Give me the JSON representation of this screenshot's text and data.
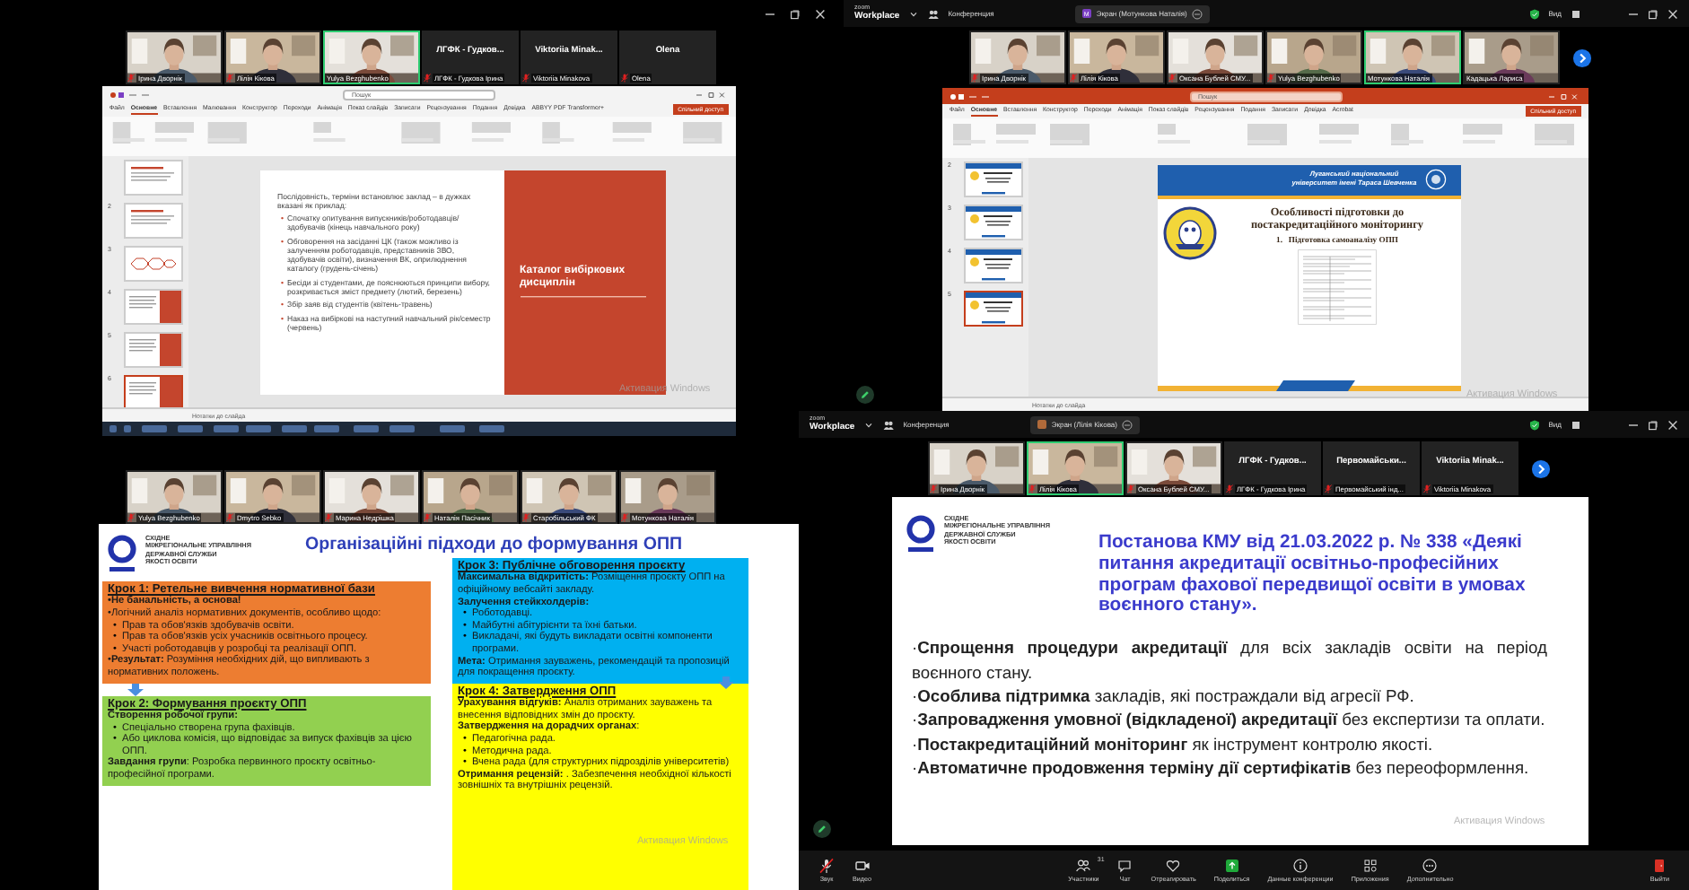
{
  "top_left": {
    "participants": [
      {
        "kind": "video",
        "label": "Ірина Дворнік",
        "muted": true,
        "active_speaker": false
      },
      {
        "kind": "video",
        "label": "Лілія Кікова",
        "muted": true,
        "active_speaker": false
      },
      {
        "kind": "video",
        "label": "Yulya Bezghubenko",
        "muted": false,
        "active_speaker": true
      },
      {
        "kind": "name",
        "name": "ЛГФК - Гудков...",
        "label": "ЛГФК - Гудкова Ірина",
        "muted": true,
        "active_speaker": false
      },
      {
        "kind": "name",
        "name": "Viktoriia Minak...",
        "label": "Viktoriia Minakova",
        "muted": true,
        "active_speaker": false
      },
      {
        "kind": "name",
        "name": "Olena",
        "label": "Olena",
        "muted": true,
        "active_speaker": false
      }
    ],
    "powerpoint": {
      "kind": "light",
      "search": "Пошук",
      "share_button": "Спільний доступ",
      "notes": "Нотатки до слайда",
      "tabs": [
        {
          "label": "Файл",
          "selected": false
        },
        {
          "label": "Основне",
          "selected": true
        },
        {
          "label": "Вставлення",
          "selected": false
        },
        {
          "label": "Малювання",
          "selected": false
        },
        {
          "label": "Конструктор",
          "selected": false
        },
        {
          "label": "Переходи",
          "selected": false
        },
        {
          "label": "Анімація",
          "selected": false
        },
        {
          "label": "Показ слайдів",
          "selected": false
        },
        {
          "label": "Записати",
          "selected": false
        },
        {
          "label": "Рецензування",
          "selected": false
        },
        {
          "label": "Подання",
          "selected": false
        },
        {
          "label": "Довідка",
          "selected": false
        },
        {
          "label": "ABBYY PDF Transformer+",
          "selected": false
        }
      ],
      "thumbnails": [
        {
          "kind": "text",
          "selected": false
        },
        {
          "number": "2",
          "kind": "text",
          "selected": false
        },
        {
          "number": "3",
          "kind": "diagram",
          "selected": false
        },
        {
          "number": "4",
          "kind": "red",
          "selected": false
        },
        {
          "number": "5",
          "kind": "red",
          "selected": false
        },
        {
          "number": "6",
          "kind": "red",
          "selected": true
        }
      ]
    },
    "slide": {
      "kind": "catalog",
      "intro": "Послідовність, терміни встановлює заклад – в дужках вказані як приклад:",
      "bullets": [
        {
          "marker": "•",
          "text": "Спочатку опитування випускників/роботодавців/здобувачів (кінець навчального року)"
        },
        {
          "marker": "•",
          "text": "Обговорення на засіданні ЦК (також можливо із залученням роботодавців, представників ЗВО, здобувачів освіти), визначення ВК, оприлюднення каталогу (грудень-січень)"
        },
        {
          "marker": "•",
          "text": "Бесіди зі студентами, де пояснюються принципи вибору, розкривається зміст предмету (лютий, березень)"
        },
        {
          "marker": "•",
          "text": "Збір заяв від студентів (квітень-травень)"
        },
        {
          "marker": "•",
          "text": "Наказ на вибіркові на наступний навчальний рік/семестр (червень)"
        }
      ],
      "panel_title": "Каталог вибіркових дисциплін"
    },
    "watermark": "Активация Windows"
  },
  "top_right": {
    "header": {
      "logo_top": "zoom",
      "logo_bottom": "Workplace",
      "meeting": "Конференция",
      "avatar": "M",
      "share_pill": "Экран (Мотункова Наталія)",
      "view": "Вид"
    },
    "participants": [
      {
        "kind": "video",
        "label": "Ірина Дворнік",
        "muted": true,
        "active_speaker": false
      },
      {
        "kind": "video",
        "label": "Лілія Кікова",
        "muted": true,
        "active_speaker": false
      },
      {
        "kind": "video",
        "label": "Оксана Бублей СМУ...",
        "muted": true,
        "active_speaker": false
      },
      {
        "kind": "video",
        "label": "Yulya Bezghubenko",
        "muted": true,
        "active_speaker": false
      },
      {
        "kind": "video",
        "label": "Мотункова Наталія",
        "muted": false,
        "active_speaker": true
      },
      {
        "kind": "video",
        "label": "Кадацька Лариса",
        "muted": false,
        "active_speaker": false
      }
    ],
    "powerpoint": {
      "kind": "accent",
      "search": "Пошук",
      "share_button": "Спільний доступ",
      "notes": "Нотатки до слайда",
      "tabs": [
        {
          "label": "Файл",
          "selected": false
        },
        {
          "label": "Основне",
          "selected": true
        },
        {
          "label": "Вставлення",
          "selected": false
        },
        {
          "label": "Конструктор",
          "selected": false
        },
        {
          "label": "Переходи",
          "selected": false
        },
        {
          "label": "Анімація",
          "selected": false
        },
        {
          "label": "Показ слайдів",
          "selected": false
        },
        {
          "label": "Рецензування",
          "selected": false
        },
        {
          "label": "Подання",
          "selected": false
        },
        {
          "label": "Записати",
          "selected": false
        },
        {
          "label": "Довідка",
          "selected": false
        },
        {
          "label": "Acrobat",
          "selected": false
        }
      ],
      "thumbnails": [
        {
          "number": "2",
          "kind": "blue",
          "selected": false
        },
        {
          "number": "3",
          "kind": "blue",
          "selected": false
        },
        {
          "number": "4",
          "kind": "blue",
          "selected": false
        },
        {
          "number": "5",
          "kind": "blue",
          "selected": true
        }
      ]
    },
    "slide": {
      "kind": "university",
      "university": "Луганський національний університет імені Тараса Шевченка",
      "title": "Особливості підготовки до постакредитаційного моніторингу",
      "item": "1.   Підготовка самоаналізу ОПП"
    },
    "watermark": "Активация Windows"
  },
  "bottom_left": {
    "participants": [
      {
        "kind": "video",
        "label": "Yulya Bezghubenko",
        "muted": true,
        "active_speaker": false
      },
      {
        "kind": "video",
        "label": "Dmytro Sebko",
        "muted": true,
        "active_speaker": false
      },
      {
        "kind": "video",
        "label": "Марина Недрішка",
        "muted": true,
        "active_speaker": false
      },
      {
        "kind": "video",
        "label": "Наталія Пасічник",
        "muted": true,
        "active_speaker": false
      },
      {
        "kind": "video",
        "label": "Старобільський ФК",
        "muted": true,
        "active_speaker": false
      },
      {
        "kind": "video",
        "label": "Мотункова Наталія",
        "muted": true,
        "active_speaker": false
      }
    ],
    "slide": {
      "org_lines": [
        "СХІДНЕ",
        "МІЖРЕГІОНАЛЬНЕ УПРАВЛІННЯ",
        "ДЕРЖАВНОЇ СЛУЖБИ",
        "ЯКОСТІ ОСВІТИ"
      ],
      "title": "Організаційні підходи до формування ОПП",
      "steps": [
        {
          "color": "#ed7d31",
          "heading": "Крок 1: Ретельне вивчення нормативної бази",
          "items": [
            {
              "kind": "text",
              "text": "**•Не банальність, а основа!**"
            },
            {
              "kind": "text",
              "text": "•Логічний аналіз нормативних документів, особливо щодо:"
            },
            {
              "kind": "bullet",
              "marker": "•",
              "text": "Прав та обов'язків здобувачів освіти."
            },
            {
              "kind": "bullet",
              "marker": "•",
              "text": "Прав та обов'язків усіх учасників освітнього процесу."
            },
            {
              "kind": "bullet",
              "marker": "•",
              "text": "Участі роботодавців у розробці та реалізації ОПП."
            },
            {
              "kind": "text",
              "text": "•**Результат:** Розуміння необхідних дій, що випливають з нормативних положень."
            }
          ]
        },
        {
          "color": "#92d050",
          "heading": "Крок 2: Формування проєкту ОПП",
          "items": [
            {
              "kind": "text",
              "text": "**Створення робочої групи:**"
            },
            {
              "kind": "bullet",
              "marker": "•",
              "text": "Спеціально створена група фахівців."
            },
            {
              "kind": "bullet",
              "marker": "•",
              "text": "Або циклова комісія, що відповідає за випуск фахівців за цією ОПП."
            },
            {
              "kind": "text",
              "text": "**Завдання групи**: Розробка первинного проєкту освітньо-професійної програми."
            }
          ]
        },
        {
          "color": "#00b0f0",
          "heading": "Крок 3: Публічне обговорення проєкту",
          "items": [
            {
              "kind": "text",
              "text": "**Максимальна відкритість:** Розміщення проєкту ОПП на офіційному вебсайті закладу."
            },
            {
              "kind": "text",
              "text": "**Залучення стейкхолдерів:**"
            },
            {
              "kind": "bullet",
              "marker": "•",
              "text": "Роботодавці."
            },
            {
              "kind": "bullet",
              "marker": "•",
              "text": "Майбутні абітурієнти та їхні батьки."
            },
            {
              "kind": "bullet",
              "marker": "•",
              "text": "Викладачі, які будуть викладати освітні компоненти програми."
            },
            {
              "kind": "text",
              "text": "**Мета:** Отримання зауважень, рекомендацій та пропозицій для покращення проєкту."
            }
          ]
        },
        {
          "color": "#ffff00",
          "heading": "Крок 4: Затвердження ОПП",
          "items": [
            {
              "kind": "text",
              "text": "**Урахування відгуків:** Аналіз отриманих зауважень та внесення відповідних змін до проєкту."
            },
            {
              "kind": "text",
              "text": "**Затвердження на дорадчих органах**:"
            },
            {
              "kind": "bullet",
              "marker": "•",
              "text": "Педагогічна рада."
            },
            {
              "kind": "bullet",
              "marker": "•",
              "text": "Методична рада."
            },
            {
              "kind": "bullet",
              "marker": "•",
              "text": "Вчена рада (для структурних підрозділів університетів)"
            },
            {
              "kind": "text",
              "text": "**Отримання рецензій:** . Забезпечення необхідної кількості зовнішніх та внутрішніх рецензій."
            }
          ]
        }
      ]
    },
    "watermark": "Активация Windows"
  },
  "bottom_right": {
    "header": {
      "logo_top": "zoom",
      "logo_bottom": "Workplace",
      "meeting": "Конференция",
      "share_pill": "Экран (Лілія Кікова)",
      "view": "Вид"
    },
    "participants": [
      {
        "kind": "video",
        "label": "Ірина Дворнік",
        "muted": true,
        "active_speaker": false
      },
      {
        "kind": "video",
        "label": "Лілія Кікова",
        "muted": true,
        "active_speaker": true
      },
      {
        "kind": "video",
        "label": "Оксана Бублей СМУ...",
        "muted": true,
        "active_speaker": false
      },
      {
        "kind": "name",
        "name": "ЛГФК - Гудков...",
        "label": "ЛГФК - Гудкова Ірина",
        "muted": true,
        "active_speaker": false
      },
      {
        "kind": "name",
        "name": "Первомайськи...",
        "label": "Первомайський інд...",
        "muted": true,
        "active_speaker": false
      },
      {
        "kind": "name",
        "name": "Viktoriia Minak...",
        "label": "Viktoriia Minakova",
        "muted": true,
        "active_speaker": false
      }
    ],
    "slide": {
      "org_lines": [
        "СХІДНЕ",
        "МІЖРЕГІОНАЛЬНЕ УПРАВЛІННЯ",
        "ДЕРЖАВНОЇ СЛУЖБИ",
        "ЯКОСТІ ОСВІТИ"
      ],
      "title": "Постанова КМУ від 21.03.2022 р. № 338 «Деякі питання акредитації освітньо-професійних програм фахової передвищої освіти в умовах воєнного стану».",
      "points": [
        "·**Спрощення процедури акредитації** для всіх закладів освіти на період воєнного стану.",
        "·**Особлива підтримка** закладів, які постраждали від агресії РФ.",
        "·**Запровадження умовної (відкладеної) акредитації** без експертизи та оплати.",
        "·**Постакредитаційний моніторинг** як інструмент контролю якості.",
        "·**Автоматичне продовження терміну дії сертифікатів** без переоформлення."
      ]
    },
    "toolbar": [
      {
        "kind": "audio",
        "label": "Звук",
        "muted": true
      },
      {
        "kind": "video",
        "label": "Видео",
        "muted": false
      },
      {
        "kind": "participants",
        "label": "Участники",
        "count": "31",
        "muted": false
      },
      {
        "kind": "chat",
        "label": "Чат",
        "muted": false
      },
      {
        "kind": "react",
        "label": "Отреагировать",
        "muted": false
      },
      {
        "kind": "share",
        "label": "Поделиться",
        "muted": false
      },
      {
        "kind": "info",
        "label": "Данные конференции",
        "muted": false
      },
      {
        "kind": "apps",
        "label": "Приложения",
        "muted": false
      },
      {
        "kind": "more",
        "label": "Дополнительно",
        "muted": false
      },
      {
        "kind": "leave",
        "label": "Выйти",
        "muted": false
      }
    ],
    "watermark": "Активация Windows"
  }
}
